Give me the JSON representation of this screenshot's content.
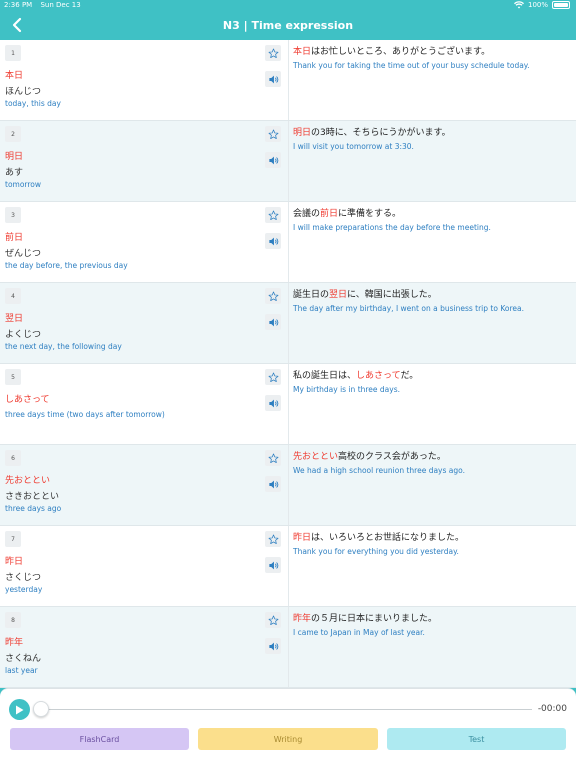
{
  "status_bar": {
    "time": "2:36 PM",
    "date": "Sun Dec 13",
    "battery": "100%",
    "battery_level": 1.0
  },
  "nav": {
    "title": "N3 | Time expression"
  },
  "items": [
    {
      "num": "1",
      "word": "本日",
      "reading": "ほんじつ",
      "meaning": "today, this day",
      "sentence": [
        {
          "t": "本日",
          "hl": true
        },
        {
          "t": "はお忙しいところ、ありがとうございます。",
          "hl": false
        }
      ],
      "translation": "Thank you for taking the time out of your busy schedule today."
    },
    {
      "num": "2",
      "word": "明日",
      "reading": "あす",
      "meaning": "tomorrow",
      "sentence": [
        {
          "t": "明日",
          "hl": true
        },
        {
          "t": "の3時に、そちらにうかがいます。",
          "hl": false
        }
      ],
      "translation": "I will visit you tomorrow at 3:30."
    },
    {
      "num": "3",
      "word": "前日",
      "reading": "ぜんじつ",
      "meaning": "the day before, the previous day",
      "sentence": [
        {
          "t": "会議の",
          "hl": false
        },
        {
          "t": "前日",
          "hl": true
        },
        {
          "t": "に準備をする。",
          "hl": false
        }
      ],
      "translation": "I will make preparations the day before the meeting."
    },
    {
      "num": "4",
      "word": "翌日",
      "reading": "よくじつ",
      "meaning": "the next day, the following day",
      "sentence": [
        {
          "t": "誕生日の",
          "hl": false
        },
        {
          "t": "翌日",
          "hl": true
        },
        {
          "t": "に、韓国に出張した。",
          "hl": false
        }
      ],
      "translation": "The day after my birthday, I went on a business trip to Korea."
    },
    {
      "num": "5",
      "word": "しあさって",
      "reading": "",
      "meaning": "three days time (two days after tomorrow)",
      "sentence": [
        {
          "t": "私の誕生日は、",
          "hl": false
        },
        {
          "t": "しあさって",
          "hl": true
        },
        {
          "t": "だ。",
          "hl": false
        }
      ],
      "translation": "My birthday is in three days."
    },
    {
      "num": "6",
      "word": "先おととい",
      "reading": "さきおととい",
      "meaning": "three days ago",
      "sentence": [
        {
          "t": "先おととい",
          "hl": true
        },
        {
          "t": "高校のクラス会があった。",
          "hl": false
        }
      ],
      "translation": "We had a high school reunion three days ago."
    },
    {
      "num": "7",
      "word": "昨日",
      "reading": "さくじつ",
      "meaning": "yesterday",
      "sentence": [
        {
          "t": "昨日",
          "hl": true
        },
        {
          "t": "は、いろいろとお世話になりました。",
          "hl": false
        }
      ],
      "translation": "Thank you for everything you did yesterday."
    },
    {
      "num": "8",
      "word": "昨年",
      "reading": "さくねん",
      "meaning": "last year",
      "sentence": [
        {
          "t": "昨年",
          "hl": true
        },
        {
          "t": "の５月に日本にまいりました。",
          "hl": false
        }
      ],
      "translation": "I came to Japan in May of last year."
    }
  ],
  "player": {
    "time": "-00:00",
    "progress": 0
  },
  "buttons": {
    "flashcard": "FlashCard",
    "writing": "Writing",
    "test": "Test"
  },
  "colors": {
    "accent": "#3fc1c5",
    "highlight": "#ef3a2f",
    "translation": "#2e7fc1"
  },
  "icons": {
    "back": "chevron-left-icon",
    "star": "star-outline-icon",
    "speaker": "speaker-icon",
    "play": "play-icon",
    "wifi": "wifi-icon",
    "battery": "battery-icon"
  }
}
